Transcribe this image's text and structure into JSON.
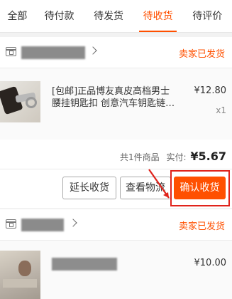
{
  "tabs": [
    {
      "label": "全部",
      "active": false
    },
    {
      "label": "待付款",
      "active": false
    },
    {
      "label": "待发货",
      "active": false
    },
    {
      "label": "待收货",
      "active": true
    },
    {
      "label": "待评价",
      "active": false
    }
  ],
  "orders": [
    {
      "status": "卖家已发货",
      "title_line1": "[包邮]正品博友真皮高档男士",
      "title_line2": "腰挂钥匙扣 创意汽车钥匙链…",
      "price": "¥12.80",
      "qty": "x1",
      "summary_count": "共1件商品",
      "paid_label": "实付:",
      "paid_value": "¥5.67",
      "buttons": {
        "extend": "延长收货",
        "track": "查看物流",
        "confirm": "确认收货"
      }
    },
    {
      "status": "卖家已发货",
      "price": "¥10.00"
    }
  ],
  "colors": {
    "accent": "#ff5000",
    "highlight": "#e0231b"
  }
}
